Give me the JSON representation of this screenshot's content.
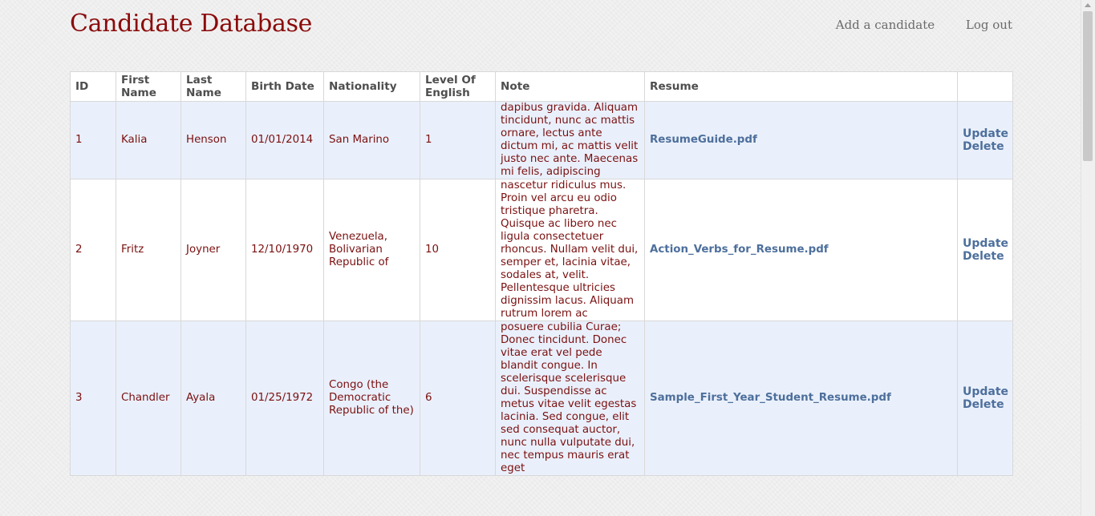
{
  "page": {
    "title": "Candidate Database"
  },
  "nav": {
    "add_label": "Add a candidate",
    "logout_label": "Log out"
  },
  "table": {
    "headers": {
      "id": "ID",
      "first": "First Name",
      "last": "Last Name",
      "birth": "Birth Date",
      "nationality": "Nationality",
      "english": "Level Of English",
      "note": "Note",
      "resume": "Resume",
      "actions": ""
    },
    "rows": [
      {
        "id": "1",
        "first": "Kalia",
        "last": "Henson",
        "birth": "01/01/2014",
        "nationality": "San Marino",
        "english": "1",
        "note": "dapibus gravida. Aliquam tincidunt, nunc ac mattis ornare, lectus ante dictum mi, ac mattis velit justo nec ante. Maecenas mi felis, adipiscing",
        "resume": "ResumeGuide.pdf",
        "update": "Update",
        "delete": "Delete"
      },
      {
        "id": "2",
        "first": "Fritz",
        "last": "Joyner",
        "birth": "12/10/1970",
        "nationality": "Venezuela, Bolivarian Republic of",
        "english": "10",
        "note": "nascetur ridiculus mus. Proin vel arcu eu odio tristique pharetra. Quisque ac libero nec ligula consectetuer rhoncus. Nullam velit dui, semper et, lacinia vitae, sodales at, velit. Pellentesque ultricies dignissim lacus. Aliquam rutrum lorem ac",
        "resume": "Action_Verbs_for_Resume.pdf",
        "update": "Update",
        "delete": "Delete"
      },
      {
        "id": "3",
        "first": "Chandler",
        "last": "Ayala",
        "birth": "01/25/1972",
        "nationality": "Congo (the Democratic Republic of the)",
        "english": "6",
        "note": "posuere cubilia Curae; Donec tincidunt. Donec vitae erat vel pede blandit congue. In scelerisque scelerisque dui. Suspendisse ac metus vitae velit egestas lacinia. Sed congue, elit sed consequat auctor, nunc nulla vulputate dui, nec tempus mauris erat eget",
        "resume": "Sample_First_Year_Student_Resume.pdf",
        "update": "Update",
        "delete": "Delete"
      }
    ]
  }
}
